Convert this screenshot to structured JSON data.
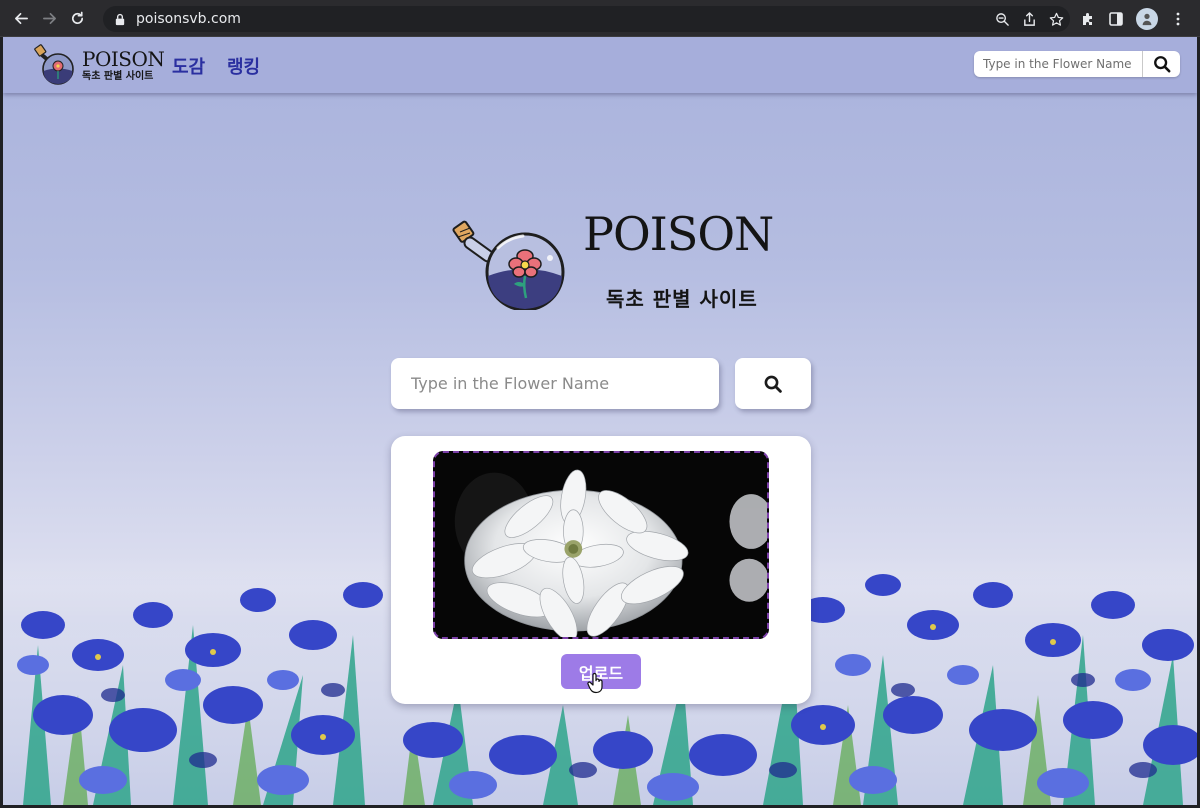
{
  "browser": {
    "url": "poisonsvb.com"
  },
  "nav": {
    "brand_title": "POISON",
    "brand_subtitle": "독초 판별 사이트",
    "links": [
      "도감",
      "랭킹"
    ],
    "search_placeholder": "Type in the Flower Name"
  },
  "hero": {
    "title": "POISON",
    "subtitle": "독초 판별 사이트"
  },
  "search": {
    "placeholder": "Type in the Flower Name"
  },
  "upload": {
    "button_label": "업로드"
  },
  "colors": {
    "nav_bg": "#a6aedb",
    "nav_link": "#2a2fa0",
    "upload_button": "#9d7be7",
    "preview_border": "#7b3fa8",
    "iris_blue": "#3646c8"
  },
  "icons": {
    "search": "search-icon",
    "back": "arrow-left-icon",
    "forward": "arrow-right-icon",
    "reload": "reload-icon",
    "lock": "lock-icon"
  }
}
